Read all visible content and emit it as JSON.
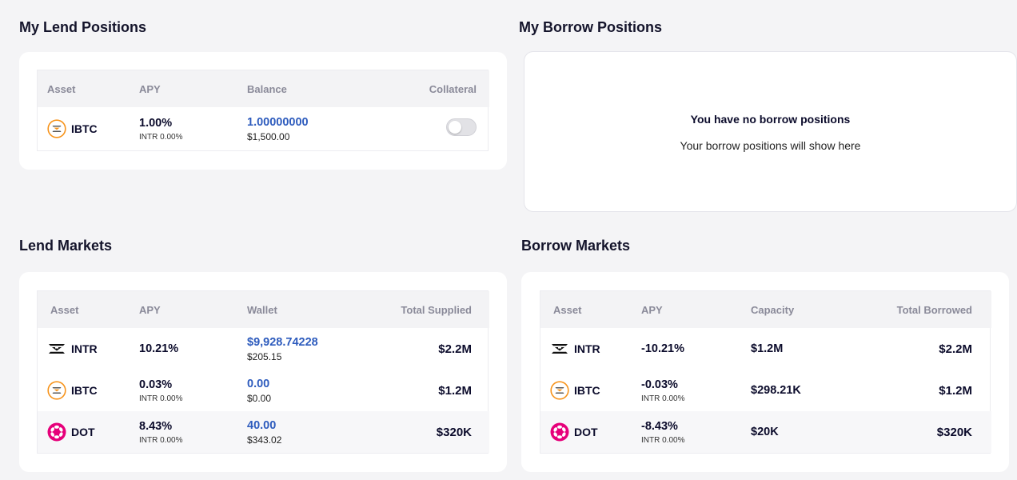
{
  "lend_positions": {
    "title": "My Lend Positions",
    "headers": [
      "Asset",
      "APY",
      "Balance",
      "Collateral"
    ],
    "rows": [
      {
        "asset": "IBTC",
        "icon": "ibtc-icon",
        "apy": "1.00%",
        "apy_sub": "INTR 0.00%",
        "balance": "1.00000000",
        "balance_usd": "$1,500.00",
        "collateral_enabled": false
      }
    ]
  },
  "borrow_positions": {
    "title": "My Borrow Positions",
    "empty_title": "You have no borrow positions",
    "empty_subtitle": "Your borrow positions will show here"
  },
  "lend_markets": {
    "title": "Lend Markets",
    "headers": [
      "Asset",
      "APY",
      "Wallet",
      "Total Supplied"
    ],
    "rows": [
      {
        "asset": "INTR",
        "icon": "intr-icon",
        "apy": "10.21%",
        "apy_sub": "",
        "wallet": "$9,928.74228",
        "wallet_usd": "$205.15",
        "total": "$2.2M"
      },
      {
        "asset": "IBTC",
        "icon": "ibtc-icon",
        "apy": "0.03%",
        "apy_sub": "INTR 0.00%",
        "wallet": "0.00",
        "wallet_usd": "$0.00",
        "total": "$1.2M"
      },
      {
        "asset": "DOT",
        "icon": "dot-icon",
        "apy": "8.43%",
        "apy_sub": "INTR 0.00%",
        "wallet": "40.00",
        "wallet_usd": "$343.02",
        "total": "$320K"
      }
    ]
  },
  "borrow_markets": {
    "title": "Borrow Markets",
    "headers": [
      "Asset",
      "APY",
      "Capacity",
      "Total Borrowed"
    ],
    "rows": [
      {
        "asset": "INTR",
        "icon": "intr-icon",
        "apy": "-10.21%",
        "apy_sub": "",
        "capacity": "$1.2M",
        "total": "$2.2M"
      },
      {
        "asset": "IBTC",
        "icon": "ibtc-icon",
        "apy": "-0.03%",
        "apy_sub": "INTR 0.00%",
        "capacity": "$298.21K",
        "total": "$1.2M"
      },
      {
        "asset": "DOT",
        "icon": "dot-icon",
        "apy": "-8.43%",
        "apy_sub": "INTR 0.00%",
        "capacity": "$20K",
        "total": "$320K"
      }
    ]
  },
  "colors": {
    "accent_blue": "#2d5bbd",
    "dot_pink": "#e6007a",
    "ibtc_orange": "#f7931a",
    "text_dark": "#0b0b2b"
  }
}
